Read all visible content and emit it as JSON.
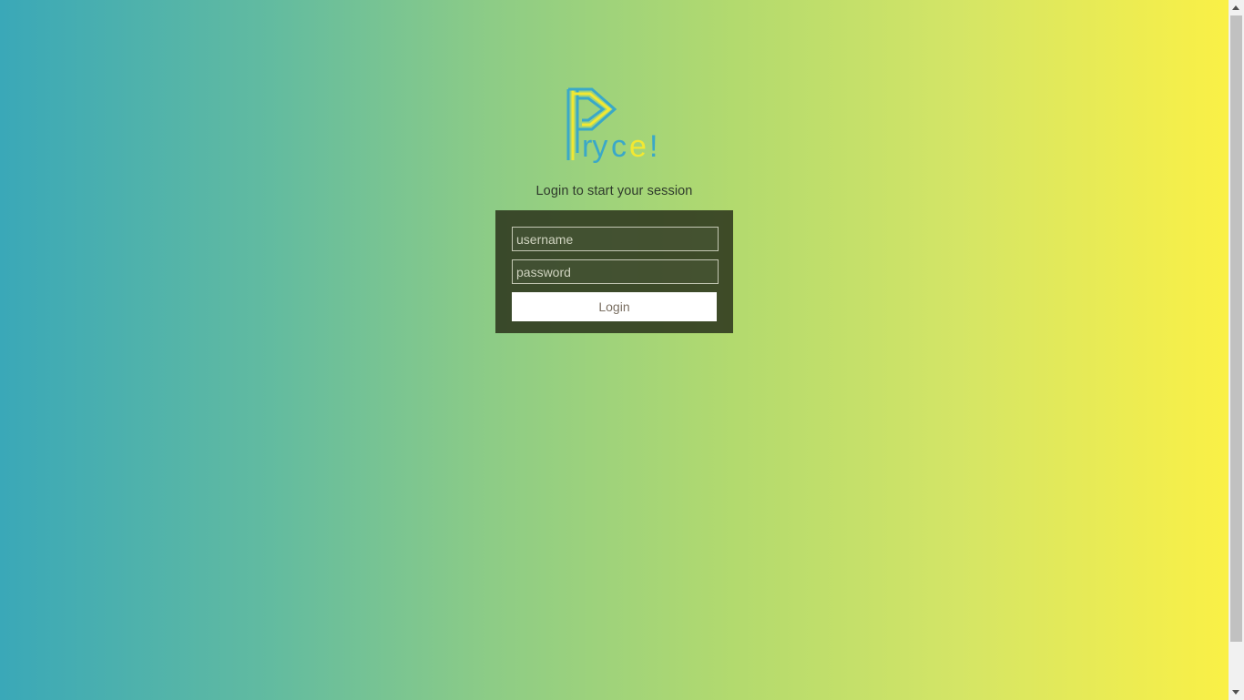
{
  "login": {
    "subtitle": "Login to start your session",
    "username_placeholder": "username",
    "password_placeholder": "password",
    "button_label": "Login"
  },
  "logo": {
    "text": "Pryce!",
    "colors": {
      "teal": "#3aa8c8",
      "yellow": "#f2e832"
    }
  },
  "scrollbar": {
    "icons": [
      "scroll-up-arrow-icon",
      "scroll-down-arrow-icon"
    ]
  },
  "colors": {
    "gradient_start": "#3aa8b8",
    "gradient_end": "#faf046",
    "panel_bg": "#2d371e",
    "button_text": "#7a6f62"
  }
}
